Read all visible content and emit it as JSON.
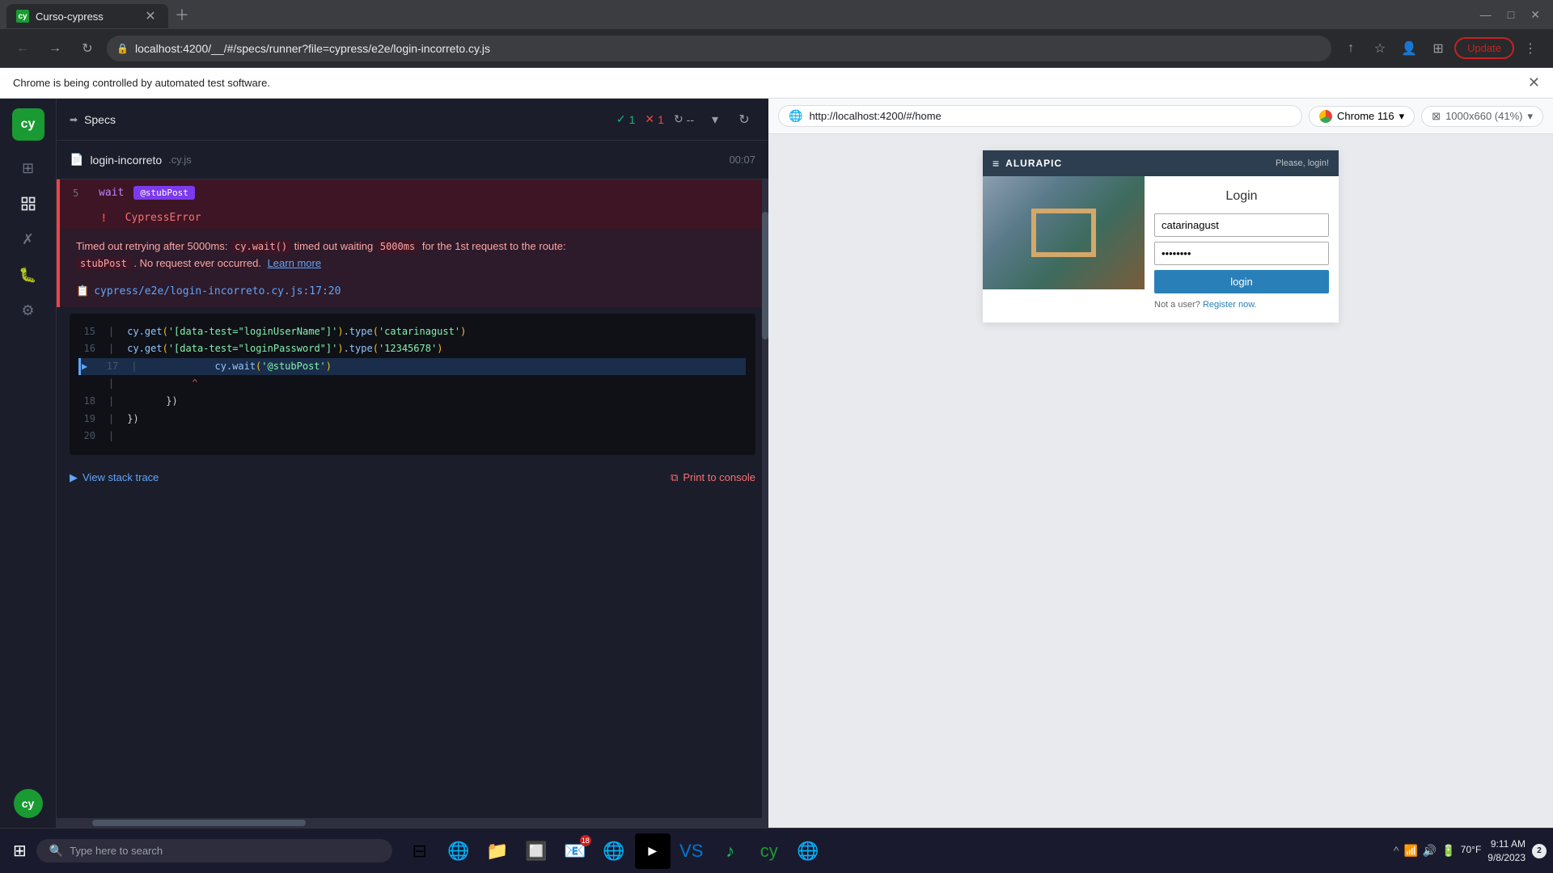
{
  "browser": {
    "tab_title": "Curso-cypress",
    "url": "localhost:4200/__/#/specs/runner?file=cypress/e2e/login-incorreto.cy.js",
    "update_label": "Update",
    "info_bar_text": "Chrome is being controlled by automated test software."
  },
  "cypress": {
    "specs_label": "Specs",
    "test_file": "login-incorreto",
    "test_ext": ".cy.js",
    "test_time": "00:07",
    "pass_count": "1",
    "fail_count": "1",
    "spin_count": "--",
    "error": {
      "line_num": "5",
      "keyword": "wait",
      "badge": "@stubPost",
      "error_type": "CypressError",
      "message_1": "Timed out retrying after 5000ms:",
      "message_code1": "cy.wait()",
      "message_2": "timed out waiting",
      "message_code2": "5000ms",
      "message_3": "for the 1st request to the route:",
      "message_code3": "stubPost",
      "message_4": ". No request ever occurred.",
      "message_link": "Learn more",
      "file_link": "cypress/e2e/login-incorreto.cy.js:17:20",
      "code_lines": [
        {
          "num": "15",
          "content": "cy.get('[data-test=\"loginUserName\"]').type('catarinagust')"
        },
        {
          "num": "16",
          "content": "cy.get('[data-test=\"loginPassword\"]').type('12345678')"
        },
        {
          "num": "17",
          "content": "cy.wait('@stubPost')",
          "active": true
        },
        {
          "num": "",
          "content": "^"
        },
        {
          "num": "18",
          "content": "})"
        },
        {
          "num": "19",
          "content": "})"
        },
        {
          "num": "20",
          "content": ""
        }
      ],
      "view_stack_label": "View stack trace",
      "print_console_label": "Print to console"
    }
  },
  "preview": {
    "url": "http://localhost:4200/#/home",
    "browser_label": "Chrome 116",
    "size_label": "1000x660 (41%)"
  },
  "login_app": {
    "brand_name": "ALURAPIC",
    "please_label": "Please, login!",
    "title": "Login",
    "username_value": "catarinagust",
    "password_value": "••••••••",
    "login_button": "login",
    "register_text": "Not a user?",
    "register_link": "Register now."
  },
  "taskbar": {
    "search_placeholder": "Type here to search",
    "time": "9:11 AM",
    "date": "9/8/2023",
    "notification_count": "2",
    "temperature": "70°F"
  }
}
